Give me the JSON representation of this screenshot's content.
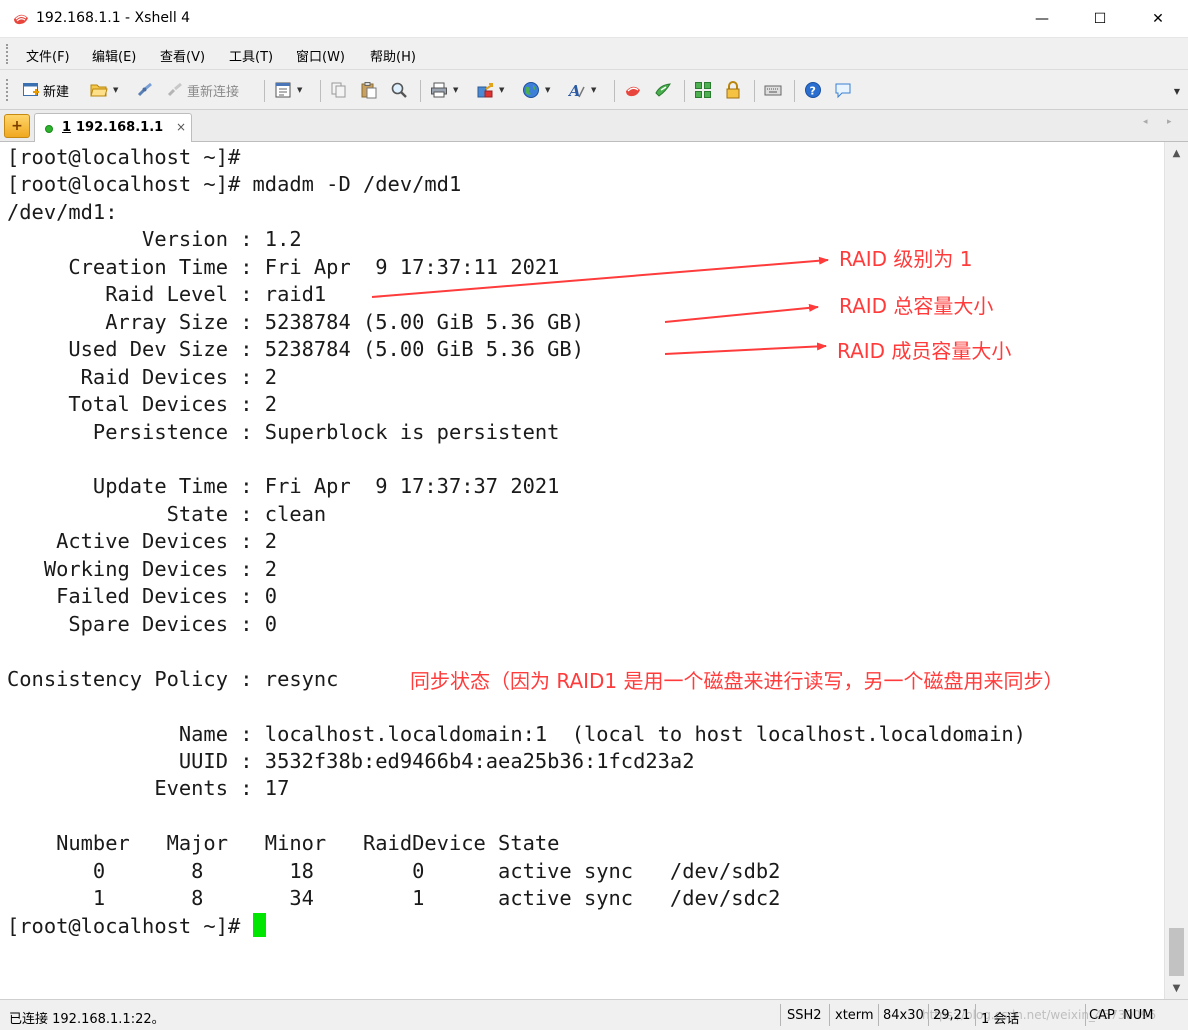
{
  "window": {
    "title": "192.168.1.1 - Xshell 4",
    "minimize_glyph": "—",
    "maximize_glyph": "☐",
    "close_glyph": "✕"
  },
  "menu": {
    "items": [
      {
        "label": "文件(F)"
      },
      {
        "label": "编辑(E)"
      },
      {
        "label": "查看(V)"
      },
      {
        "label": "工具(T)"
      },
      {
        "label": "窗口(W)"
      },
      {
        "label": "帮助(H)"
      }
    ]
  },
  "toolbar": {
    "new_label": "新建",
    "reconnect_label": "重新连接",
    "dropdown_glyph": "▼"
  },
  "tabs": {
    "add_glyph": "+",
    "items": [
      {
        "number": "1",
        "label": "192.168.1.1",
        "close_glyph": "×"
      }
    ],
    "nav_left": "◂",
    "nav_right": "▸"
  },
  "terminal": {
    "lines": [
      "[root@localhost ~]#",
      "[root@localhost ~]# mdadm -D /dev/md1",
      "/dev/md1:",
      "           Version : 1.2",
      "     Creation Time : Fri Apr  9 17:37:11 2021",
      "        Raid Level : raid1",
      "        Array Size : 5238784 (5.00 GiB 5.36 GB)",
      "     Used Dev Size : 5238784 (5.00 GiB 5.36 GB)",
      "      Raid Devices : 2",
      "     Total Devices : 2",
      "       Persistence : Superblock is persistent",
      "",
      "       Update Time : Fri Apr  9 17:37:37 2021",
      "             State : clean",
      "    Active Devices : 2",
      "   Working Devices : 2",
      "    Failed Devices : 0",
      "     Spare Devices : 0",
      "",
      "Consistency Policy : resync",
      "",
      "              Name : localhost.localdomain:1  (local to host localhost.localdomain)",
      "              UUID : 3532f38b:ed9466b4:aea25b36:1fcd23a2",
      "            Events : 17",
      "",
      "    Number   Major   Minor   RaidDevice State",
      "       0       8       18        0      active sync   /dev/sdb2",
      "       1       8       34        1      active sync   /dev/sdc2"
    ],
    "prompt": "[root@localhost ~]# "
  },
  "annotations": {
    "raid_level": "RAID 级别为 1",
    "array_size": "RAID 总容量大小",
    "used_dev_size": "RAID 成员容量大小",
    "consistency": "同步状态（因为 RAID1 是用一个磁盘来进行读写，另一个磁盘用来同步）",
    "color": "#ff3b3b"
  },
  "scrollbar": {
    "up_glyph": "▲",
    "down_glyph": "▼"
  },
  "status": {
    "connection": "已连接 192.168.1.1:22。",
    "protocol": "SSH2",
    "terminal_type": "xterm",
    "size": "84x30",
    "cursor_pos": "29,21",
    "sessions": "1 会话",
    "caps": "CAP",
    "num": "NUM",
    "watermark": "https://blog.csdn.net/weixin_45730096"
  },
  "colors": {
    "cursor": "#00e600",
    "terminal_bg": "#ffffff",
    "terminal_fg": "#1a1a1a"
  }
}
